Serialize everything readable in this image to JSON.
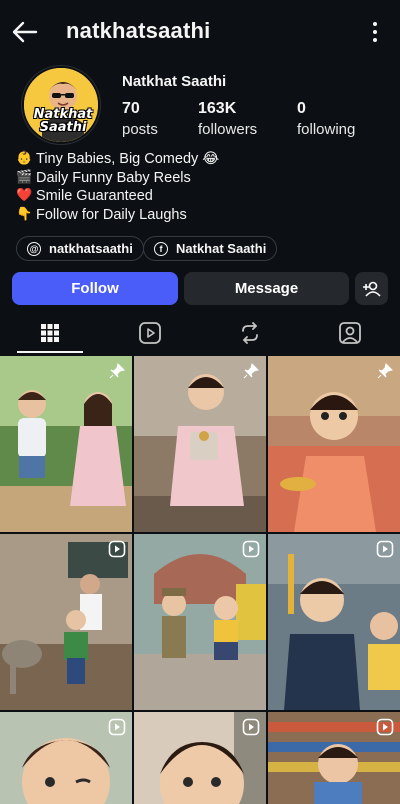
{
  "header": {
    "username": "natkhatsaathi"
  },
  "profile": {
    "display_name": "Natkhat Saathi",
    "avatar_text_line1": "Natkhat",
    "avatar_text_line2": "Saathi",
    "stats": [
      {
        "value": "70",
        "label": "posts"
      },
      {
        "value": "163K",
        "label": "followers"
      },
      {
        "value": "0",
        "label": "following"
      }
    ],
    "bio": [
      {
        "emoji": "👶",
        "text": "Tiny Babies, Big Comedy 😂"
      },
      {
        "emoji": "🎬",
        "text": "Daily Funny Baby Reels"
      },
      {
        "emoji": "❤️",
        "text": "Smile Guaranteed"
      },
      {
        "emoji": "👇",
        "text": "Follow for Daily Laughs"
      }
    ],
    "links": [
      {
        "label": "natkhatsaathi",
        "icon": "threads-icon"
      },
      {
        "label": "Natkhat Saathi",
        "icon": "facebook-icon"
      }
    ]
  },
  "actions": {
    "follow": "Follow",
    "message": "Message"
  },
  "tabs": [
    "grid-icon",
    "reels-icon",
    "remix-icon",
    "tagged-icon"
  ],
  "colors": {
    "background": "#0c1014",
    "accent": "#4a5df9",
    "button": "#25292e"
  }
}
